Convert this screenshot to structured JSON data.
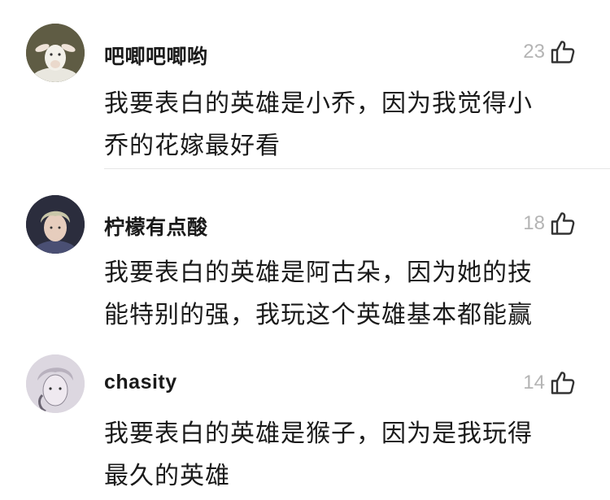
{
  "comments": [
    {
      "username": "吧唧吧唧哟",
      "likes": "23",
      "text_lines": [
        "我要表白的英雄是小乔，因为我觉得小",
        "乔的花嫁最好看"
      ],
      "avatar_icon": "white-goat-avatar"
    },
    {
      "username": "柠檬有点酸",
      "likes": "18",
      "text_lines": [
        "我要表白的英雄是阿古朵，因为她的技",
        "能特别的强，我玩这个英雄基本都能赢"
      ],
      "avatar_icon": "person-portrait-avatar"
    },
    {
      "username": "chasity",
      "likes": "14",
      "text_lines": [
        "我要表白的英雄是猴子，因为是我玩得",
        "最久的英雄"
      ],
      "avatar_icon": "sketch-face-avatar"
    }
  ],
  "colors": {
    "username": "#1a1a1a",
    "like_count": "#b4b4b4",
    "like_icon": "#333333",
    "divider": "#e6e6e6"
  },
  "like_icon": "thumbs-up-icon"
}
